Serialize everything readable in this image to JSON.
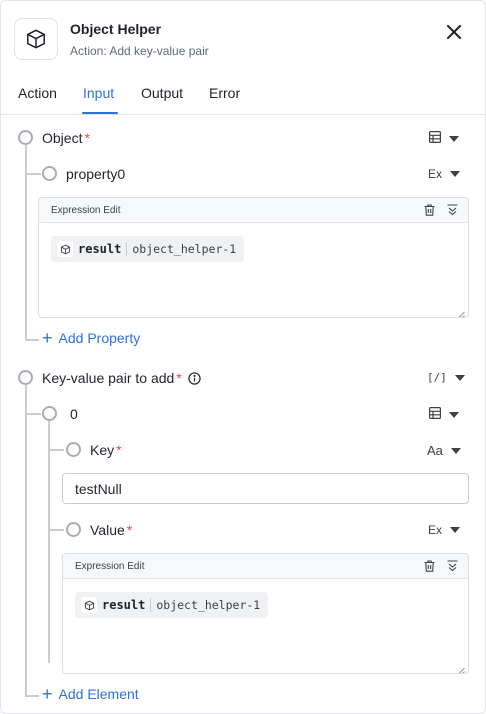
{
  "header": {
    "icon": "cube-icon",
    "title": "Object Helper",
    "subtitle": "Action: Add key-value pair"
  },
  "tabs": [
    {
      "label": "Action",
      "active": false
    },
    {
      "label": "Input",
      "active": true
    },
    {
      "label": "Output",
      "active": false
    },
    {
      "label": "Error",
      "active": false
    }
  ],
  "object_field": {
    "label": "Object",
    "required_mark": "*",
    "type_icon": "table-icon",
    "property": {
      "label": "property0",
      "type": "Ex",
      "editor_title": "Expression Edit",
      "chip_var": "result",
      "chip_src": "object_helper-1"
    },
    "add_label": "Add Property"
  },
  "kv_field": {
    "label": "Key-value pair to add",
    "required_mark": "*",
    "type": "[/]",
    "element": {
      "label": "0",
      "type_icon": "table-icon",
      "key": {
        "label": "Key",
        "required_mark": "*",
        "type": "Aa",
        "value": "testNull"
      },
      "value": {
        "label": "Value",
        "required_mark": "*",
        "type": "Ex",
        "editor_title": "Expression Edit",
        "chip_var": "result",
        "chip_src": "object_helper-1"
      }
    },
    "add_label": "Add Element"
  },
  "colors": {
    "accent": "#2f6fe4",
    "required": "#e5484d",
    "border": "#d9dce0"
  }
}
